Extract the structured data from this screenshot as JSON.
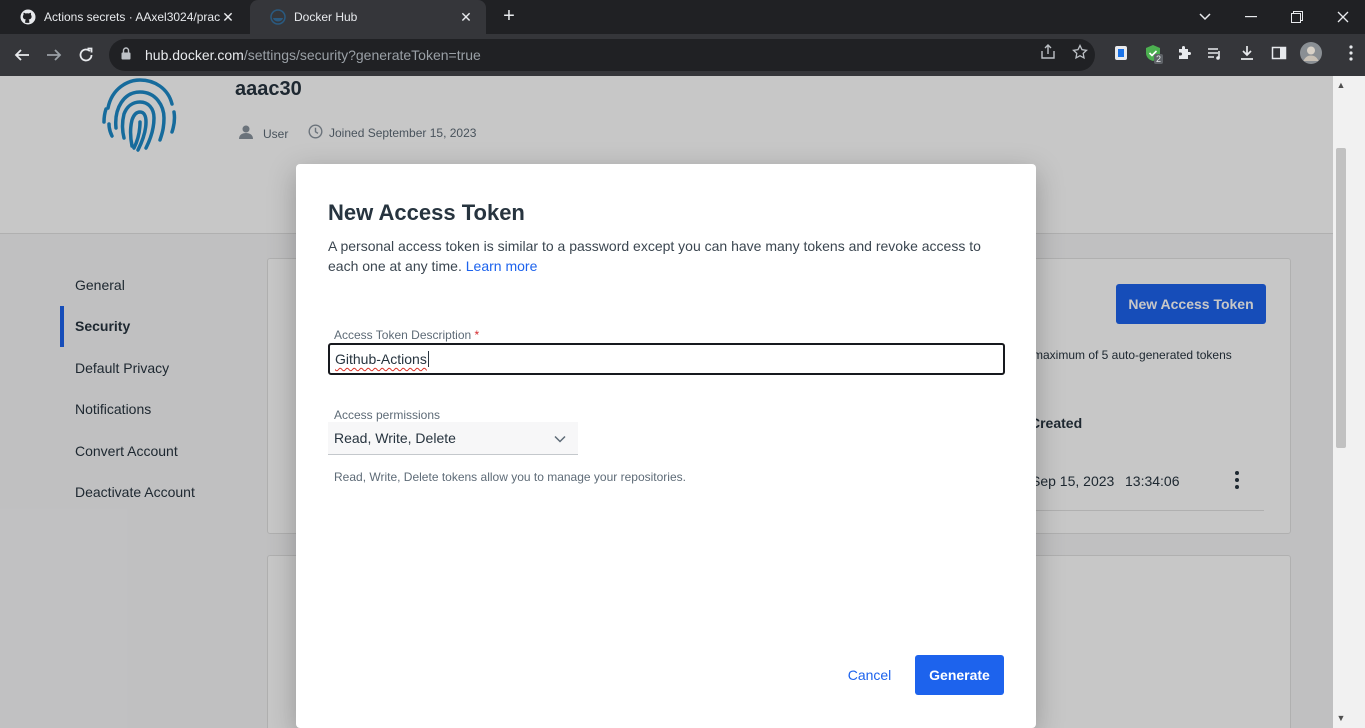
{
  "browser": {
    "tabs": [
      {
        "title": "Actions secrets · AAxel3024/prac",
        "active": false
      },
      {
        "title": "Docker Hub",
        "active": true
      }
    ],
    "url_host": "hub.docker.com",
    "url_path": "/settings/security?generateToken=true",
    "extension_badge": "2"
  },
  "profile": {
    "username": "aaac30",
    "role": "User",
    "joined": "Joined September 15, 2023"
  },
  "sidebar": {
    "items": [
      {
        "label": "General",
        "active": false
      },
      {
        "label": "Security",
        "active": true
      },
      {
        "label": "Default Privacy",
        "active": false
      },
      {
        "label": "Notifications",
        "active": false
      },
      {
        "label": "Convert Account",
        "active": false
      },
      {
        "label": "Deactivate Account",
        "active": false
      }
    ]
  },
  "background_card": {
    "new_token_button": "New Access Token",
    "limit_text": "maximum of 5 auto-generated tokens",
    "created_header": "Created",
    "created_date": "Sep 15, 2023",
    "created_time": "13:34:06"
  },
  "modal": {
    "title": "New Access Token",
    "description": "A personal access token is similar to a password except you can have many tokens and revoke access to each one at any time.",
    "learn_more": "Learn more",
    "description_label": "Access Token Description",
    "required_mark": "*",
    "description_value": "Github-Actions",
    "permissions_label": "Access permissions",
    "permissions_value": "Read, Write, Delete",
    "permissions_helper": "Read, Write, Delete tokens allow you to manage your repositories.",
    "cancel_label": "Cancel",
    "generate_label": "Generate"
  },
  "colors": {
    "primary": "#1d63ed",
    "text": "#27343f",
    "fingerprint": "#1d8ac8"
  }
}
